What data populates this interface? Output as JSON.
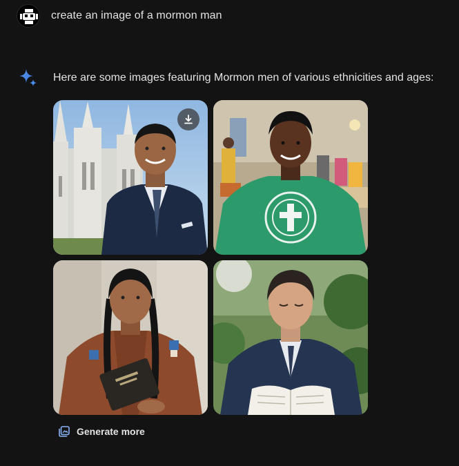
{
  "user": {
    "avatar_icon": "grid-face-avatar-icon",
    "prompt": "create an image of a mormon man"
  },
  "response": {
    "assistant_icon": "sparkle-icon",
    "intro": "Here are some images featuring Mormon men of various ethnicities and ages:",
    "images": [
      {
        "subject": "man in suit in front of temple",
        "action_icon": "download-icon"
      },
      {
        "subject": "young man in green cross t-shirt"
      },
      {
        "subject": "man with braids holding book"
      },
      {
        "subject": "man in suit reading book"
      }
    ],
    "generate_more": {
      "icon": "image-stack-icon",
      "label": "Generate more"
    }
  },
  "colors": {
    "background": "#131314",
    "text": "#e3e3e3",
    "accent_blue": "#4a8fef",
    "generate_icon": "#8ab4f8"
  }
}
